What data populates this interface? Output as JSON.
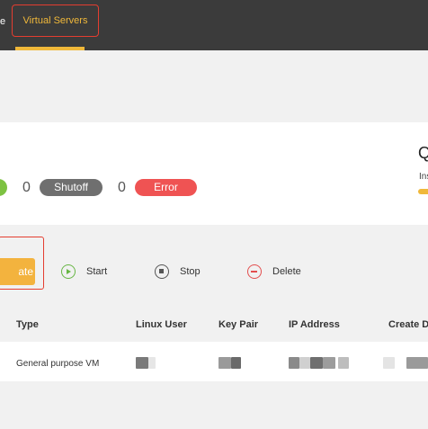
{
  "nav": {
    "prev_fragment": "e",
    "active_tab": "Virtual Servers"
  },
  "status": {
    "shutoff_count": "0",
    "shutoff_label": "Shutoff",
    "error_count": "0",
    "error_label": "Error"
  },
  "quota": {
    "title_fragment": "Q",
    "subtitle_fragment": "Ins"
  },
  "actions": {
    "create_fragment": "ate",
    "start": "Start",
    "stop": "Stop",
    "delete": "Delete"
  },
  "table": {
    "headers": [
      "Type",
      "Linux User",
      "Key Pair",
      "IP Address",
      "Create D"
    ],
    "rows": [
      {
        "type": "General purpose VM"
      }
    ]
  },
  "icons": {
    "start": "play-circle-icon",
    "stop": "stop-circle-icon",
    "delete": "minus-circle-icon"
  },
  "colors": {
    "accent": "#f0b83a",
    "highlight": "#e43d30",
    "running": "#7dc242",
    "shutoff": "#6f6f6f",
    "error": "#ef5353",
    "topbar": "#3b3b3b"
  }
}
